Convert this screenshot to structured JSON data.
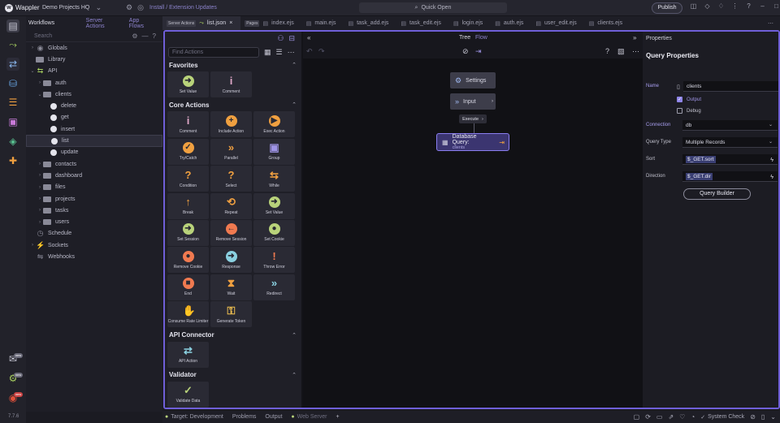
{
  "app": {
    "name": "Wappler",
    "project": "Demo Projects HQ",
    "install_link": "Install / Extension Updates",
    "quick_open": "Quick Open",
    "publish": "Publish"
  },
  "activity": {
    "version": "7.7.6",
    "badges": [
      "new",
      "new",
      "new"
    ]
  },
  "sidebar": {
    "tabs": {
      "workflows": "Workflows",
      "server_actions": "Server Actions",
      "app_flows": "App Flows"
    },
    "search_placeholder": "Search",
    "items": [
      {
        "label": "Globals",
        "kind": "globe"
      },
      {
        "label": "Library",
        "kind": "folder"
      },
      {
        "label": "API",
        "kind": "api"
      },
      {
        "label": "auth",
        "kind": "folder"
      },
      {
        "label": "clients",
        "kind": "folder"
      },
      {
        "label": "delete",
        "kind": "action"
      },
      {
        "label": "get",
        "kind": "action"
      },
      {
        "label": "insert",
        "kind": "action"
      },
      {
        "label": "list",
        "kind": "action"
      },
      {
        "label": "update",
        "kind": "action"
      },
      {
        "label": "contacts",
        "kind": "folder"
      },
      {
        "label": "dashboard",
        "kind": "folder"
      },
      {
        "label": "files",
        "kind": "folder"
      },
      {
        "label": "projects",
        "kind": "folder"
      },
      {
        "label": "tasks",
        "kind": "folder"
      },
      {
        "label": "users",
        "kind": "folder"
      },
      {
        "label": "Schedule",
        "kind": "schedule"
      },
      {
        "label": "Sockets",
        "kind": "sockets"
      },
      {
        "label": "Webhooks",
        "kind": "webhooks"
      }
    ]
  },
  "tabs": [
    {
      "tag": "Server Actions",
      "label": "list.json",
      "active": true
    },
    {
      "tag": "Pages",
      "label": "index.ejs"
    },
    {
      "label": "main.ejs"
    },
    {
      "label": "task_add.ejs"
    },
    {
      "label": "task_edit.ejs"
    },
    {
      "label": "login.ejs"
    },
    {
      "label": "auth.ejs"
    },
    {
      "label": "user_edit.ejs"
    },
    {
      "label": "clients.ejs"
    }
  ],
  "actions_panel": {
    "find_placeholder": "Find Actions",
    "sections": [
      {
        "title": "Favorites",
        "items": [
          {
            "label": "Set Value",
            "icon": "arrow-right-circle-icon",
            "color": "#b8d27a"
          },
          {
            "label": "Comment",
            "icon": "info-icon",
            "color": "#e0a8c8"
          }
        ]
      },
      {
        "title": "Core Actions",
        "items": [
          {
            "label": "Comment",
            "icon": "info-icon",
            "color": "#e0a8c8"
          },
          {
            "label": "Include Action",
            "icon": "plus-circle-icon",
            "color": "#f0a040"
          },
          {
            "label": "Exec Action",
            "icon": "play-circle-icon",
            "color": "#f0a040"
          },
          {
            "label": "Try/Catch",
            "icon": "check-circle-icon",
            "color": "#f0a040"
          },
          {
            "label": "Parallel",
            "icon": "double-chevron-icon",
            "color": "#f0a040"
          },
          {
            "label": "Group",
            "icon": "group-icon",
            "color": "#9f94e6"
          },
          {
            "label": "Condition",
            "icon": "question-icon",
            "color": "#f0a040"
          },
          {
            "label": "Select",
            "icon": "question-icon",
            "color": "#f0a040"
          },
          {
            "label": "While",
            "icon": "loop-icon",
            "color": "#f0a040"
          },
          {
            "label": "Break",
            "icon": "arrow-up-icon",
            "color": "#f0a040"
          },
          {
            "label": "Repeat",
            "icon": "repeat-icon",
            "color": "#f0a040"
          },
          {
            "label": "Set Value",
            "icon": "arrow-right-circle-icon",
            "color": "#b8d27a"
          },
          {
            "label": "Set Session",
            "icon": "arrow-right-circle-icon",
            "color": "#b8d27a"
          },
          {
            "label": "Remove Session",
            "icon": "arrow-left-circle-icon",
            "color": "#f07a50"
          },
          {
            "label": "Set Cookie",
            "icon": "cookie-icon",
            "color": "#b8d27a"
          },
          {
            "label": "Remove Cookie",
            "icon": "cookie-icon",
            "color": "#f07a50"
          },
          {
            "label": "Response",
            "icon": "arrow-right-circle-icon",
            "color": "#8ad0e0"
          },
          {
            "label": "Throw Error",
            "icon": "warning-icon",
            "color": "#f07a50"
          },
          {
            "label": "End",
            "icon": "stop-icon",
            "color": "#f07a50"
          },
          {
            "label": "Wait",
            "icon": "hourglass-icon",
            "color": "#f0a040"
          },
          {
            "label": "Redirect",
            "icon": "double-chevron-icon",
            "color": "#8ad0e0"
          },
          {
            "label": "Consume Rate Limiter",
            "icon": "hand-icon",
            "color": "#f0c050"
          },
          {
            "label": "Generate Token",
            "icon": "key-icon",
            "color": "#f0c050"
          }
        ]
      },
      {
        "title": "API Connector",
        "items": [
          {
            "label": "API Action",
            "icon": "swap-icon",
            "color": "#8ad0e0"
          }
        ]
      },
      {
        "title": "Validator",
        "items": [
          {
            "label": "Validate Data",
            "icon": "check-icon",
            "color": "#b8d27a"
          }
        ]
      }
    ]
  },
  "flow": {
    "tree": "Tree",
    "flow": "Flow",
    "settings": "Settings",
    "input": "Input",
    "execute": "Execute",
    "db_title": "Database Query:",
    "db_sub": "clients"
  },
  "properties": {
    "header": "Properties",
    "title": "Query Properties",
    "name_label": "Name",
    "name_value": "clients",
    "output": "Output",
    "debug": "Debug",
    "connection_label": "Connection",
    "connection_value": "db",
    "query_type_label": "Query Type",
    "query_type_value": "Multiple Records",
    "sort_label": "Sort",
    "sort_value": "$_GET.sort",
    "direction_label": "Direction",
    "direction_value": "$_GET.dir",
    "query_builder": "Query Builder"
  },
  "status": {
    "target": "Target:  Development",
    "problems": "Problems",
    "output": "Output",
    "web_server": "Web Server",
    "system_check": "System Check"
  }
}
